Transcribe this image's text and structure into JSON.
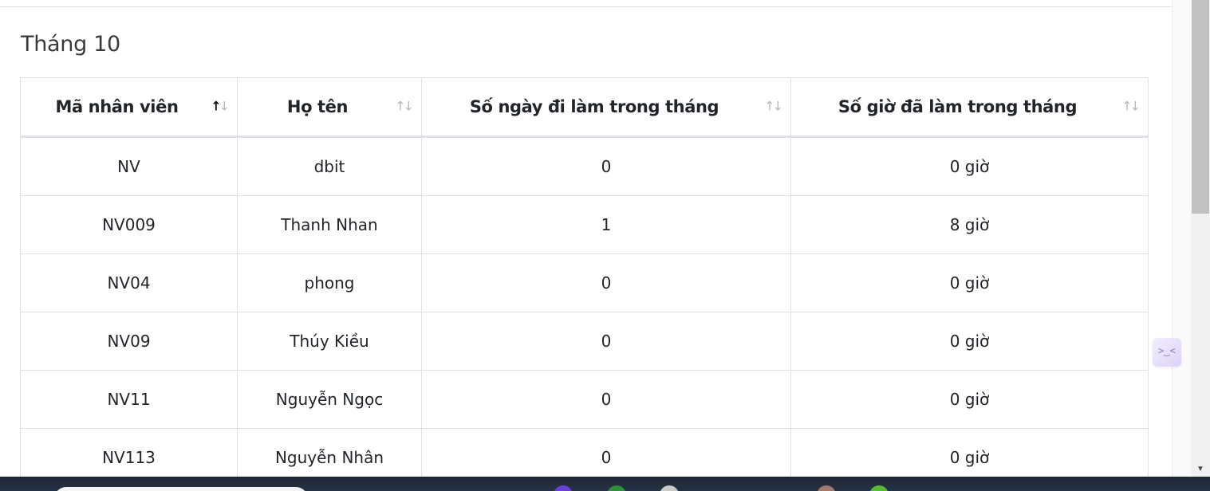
{
  "section": {
    "title": "Tháng 10"
  },
  "table": {
    "columns": [
      {
        "label": "Mã nhân viên",
        "sort": "asc"
      },
      {
        "label": "Họ tên",
        "sort": "none"
      },
      {
        "label": "Số ngày đi làm trong tháng",
        "sort": "none"
      },
      {
        "label": "Số giờ đã làm trong tháng",
        "sort": "none"
      }
    ],
    "rows": [
      {
        "id": "NV",
        "name": "dbit",
        "days": "0",
        "hours": "0 giờ"
      },
      {
        "id": "NV009",
        "name": "Thanh Nhan",
        "days": "1",
        "hours": "8 giờ"
      },
      {
        "id": "NV04",
        "name": "phong",
        "days": "0",
        "hours": "0 giờ"
      },
      {
        "id": "NV09",
        "name": "Thúy Kiều",
        "days": "0",
        "hours": "0 giờ"
      },
      {
        "id": "NV11",
        "name": "Nguyễn Ngọc",
        "days": "0",
        "hours": "0 giờ"
      },
      {
        "id": "NV113",
        "name": "Nguyễn Nhân",
        "days": "0",
        "hours": "0 giờ"
      }
    ]
  },
  "icons": {
    "sort_asc": "sort-ascending-icon",
    "sort_none": "sort-both-icon",
    "side_widget": "collapse-panel-icon"
  },
  "colors": {
    "border": "#dee2e6",
    "text": "#212529",
    "sort_inactive": "#b9b9b9",
    "taskbar": "#1d2734"
  }
}
